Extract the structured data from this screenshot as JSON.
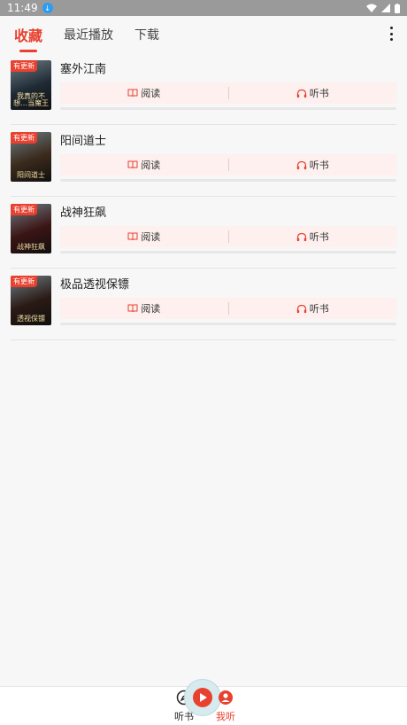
{
  "status": {
    "time": "11:49"
  },
  "tabs": [
    {
      "label": "收藏"
    },
    {
      "label": "最近播放"
    },
    {
      "label": "下载"
    }
  ],
  "books": [
    {
      "title": "塞外江南",
      "badge": "有更新",
      "cover_text": "我真的不想…当魔王",
      "cover_color": "#1e2a33",
      "progress": 0.0
    },
    {
      "title": "阳间道士",
      "badge": "有更新",
      "cover_text": "阳间道士",
      "cover_color": "#3a2a1c",
      "progress": 0.0
    },
    {
      "title": "战神狂飙",
      "badge": "有更新",
      "cover_text": "战神狂飙",
      "cover_color": "#3b1414",
      "progress": 0.0
    },
    {
      "title": "极品透视保镖",
      "badge": "有更新",
      "cover_text": "透视保镖",
      "cover_color": "#2a1a14",
      "progress": 0.0
    }
  ],
  "actions": {
    "read": "阅读",
    "listen": "听书"
  },
  "bottom_nav": {
    "listen": "听书",
    "mine": "我听",
    "fab_label": "播放"
  },
  "colors": {
    "accent": "#e8412f"
  }
}
